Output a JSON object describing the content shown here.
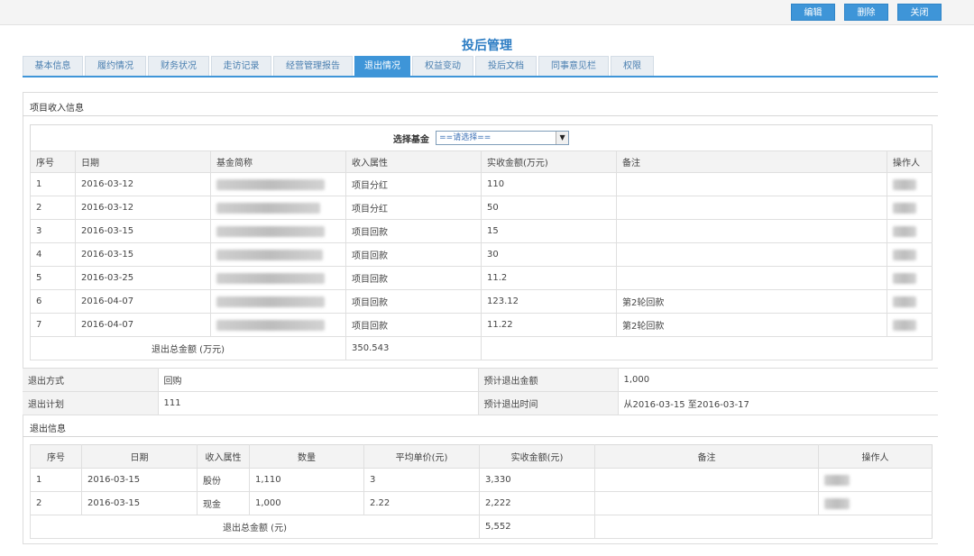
{
  "toolbar": {
    "edit": "编辑",
    "delete": "删除",
    "close": "关闭"
  },
  "page_title": "投后管理",
  "tabs": [
    "基本信息",
    "履约情况",
    "财务状况",
    "走访记录",
    "经营管理报告",
    "退出情况",
    "权益变动",
    "投后文档",
    "同事意见栏",
    "权限"
  ],
  "active_tab": "退出情况",
  "income": {
    "section_title": "项目收入信息",
    "select_label": "选择基金",
    "select_value": "==请选择==",
    "headers": [
      "序号",
      "日期",
      "基金简称",
      "收入属性",
      "实收金额(万元)",
      "备注",
      "操作人"
    ],
    "rows": [
      [
        "1",
        "2016-03-12",
        "",
        "项目分红",
        "110",
        "",
        ""
      ],
      [
        "2",
        "2016-03-12",
        "",
        "项目分红",
        "50",
        "",
        ""
      ],
      [
        "3",
        "2016-03-15",
        "",
        "项目回款",
        "15",
        "",
        ""
      ],
      [
        "4",
        "2016-03-15",
        "",
        "项目回款",
        "30",
        "",
        ""
      ],
      [
        "5",
        "2016-03-25",
        "",
        "项目回款",
        "11.2",
        "",
        ""
      ],
      [
        "6",
        "2016-04-07",
        "",
        "项目回款",
        "123.12",
        "第2轮回款",
        ""
      ],
      [
        "7",
        "2016-04-07",
        "",
        "项目回款",
        "11.22",
        "第2轮回款",
        ""
      ]
    ],
    "total_label": "退出总金额 (万元)",
    "total_value": "350.543"
  },
  "exit_plan": {
    "method_label": "退出方式",
    "method_value": "回购",
    "expected_amount_label": "预计退出金额",
    "expected_amount_value": "1,000",
    "plan_label": "退出计划",
    "plan_value": "111",
    "expected_time_label": "预计退出时间",
    "expected_time_value": "从2016-03-15 至2016-03-17"
  },
  "exit_info": {
    "section_title": "退出信息",
    "headers": [
      "序号",
      "日期",
      "收入属性",
      "数量",
      "平均单价(元)",
      "实收金额(元)",
      "备注",
      "操作人"
    ],
    "rows": [
      [
        "1",
        "2016-03-15",
        "股份",
        "1,110",
        "3",
        "3,330",
        "",
        ""
      ],
      [
        "2",
        "2016-03-15",
        "现金",
        "1,000",
        "2.22",
        "2,222",
        "",
        ""
      ]
    ],
    "total_label": "退出总金额 (元)",
    "total_value": "5,552"
  }
}
